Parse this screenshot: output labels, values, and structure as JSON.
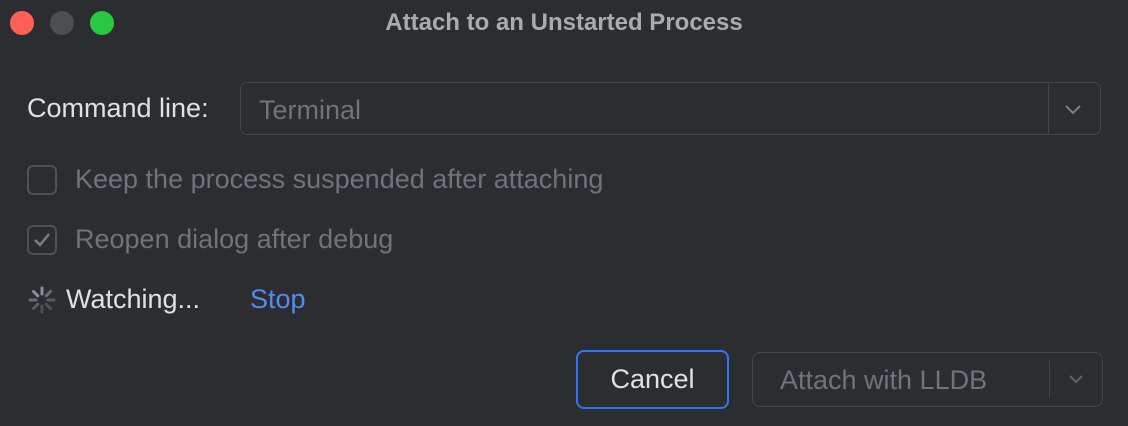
{
  "window": {
    "title": "Attach to an Unstarted Process"
  },
  "traffic_lights": {
    "close": "#ff5f57",
    "minimize": "#4d4e51",
    "maximize": "#28c840"
  },
  "form": {
    "command_line_label": "Command line:",
    "command_line_value": "Terminal",
    "options": [
      {
        "label": "Keep the process suspended after attaching",
        "checked": false
      },
      {
        "label": "Reopen dialog after debug",
        "checked": true
      }
    ]
  },
  "status": {
    "text": "Watching...",
    "stop_label": "Stop"
  },
  "buttons": {
    "cancel_label": "Cancel",
    "attach_label": "Attach with LLDB"
  },
  "colors": {
    "background": "#2b2d30",
    "accent": "#3574f0",
    "link": "#548af7",
    "disabled_text": "#6f737a"
  }
}
